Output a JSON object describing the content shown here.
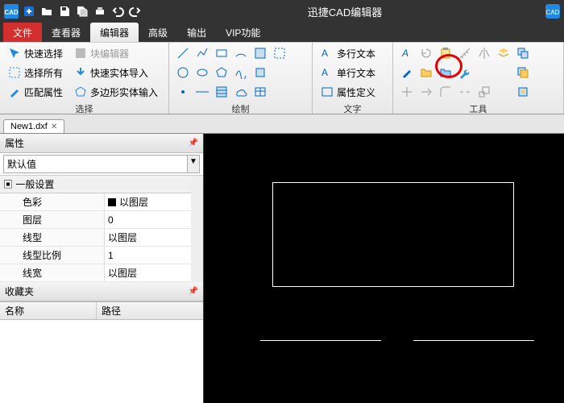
{
  "app": {
    "title": "迅捷CAD编辑器"
  },
  "menu": {
    "file": "文件",
    "viewer": "查看器",
    "editor": "编辑器",
    "advanced": "高级",
    "output": "输出",
    "vip": "VIP功能"
  },
  "ribbon": {
    "select": {
      "label": "选择",
      "quick_select": "快速选择",
      "select_all": "选择所有",
      "match_props": "匹配属性",
      "block_editor": "块编辑器",
      "import_entities": "快速实体导入",
      "polygon_input": "多边形实体输入"
    },
    "draw": {
      "label": "绘制"
    },
    "text": {
      "label": "文字",
      "mtext": "多行文本",
      "stext": "单行文本",
      "attrdef": "属性定义"
    },
    "tools": {
      "label": "工具"
    }
  },
  "doc": {
    "tab": "New1.dxf"
  },
  "panel": {
    "props_title": "属性",
    "combo_default": "默认值",
    "section_general": "一般设置",
    "rows": {
      "color_k": "色彩",
      "color_v": "以图层",
      "layer_k": "图层",
      "layer_v": "0",
      "ltype_k": "线型",
      "ltype_v": "以图层",
      "lscale_k": "线型比例",
      "lscale_v": "1",
      "lweight_k": "线宽",
      "lweight_v": "以图层"
    },
    "favorites_title": "收藏夹",
    "col_name": "名称",
    "col_path": "路径"
  }
}
